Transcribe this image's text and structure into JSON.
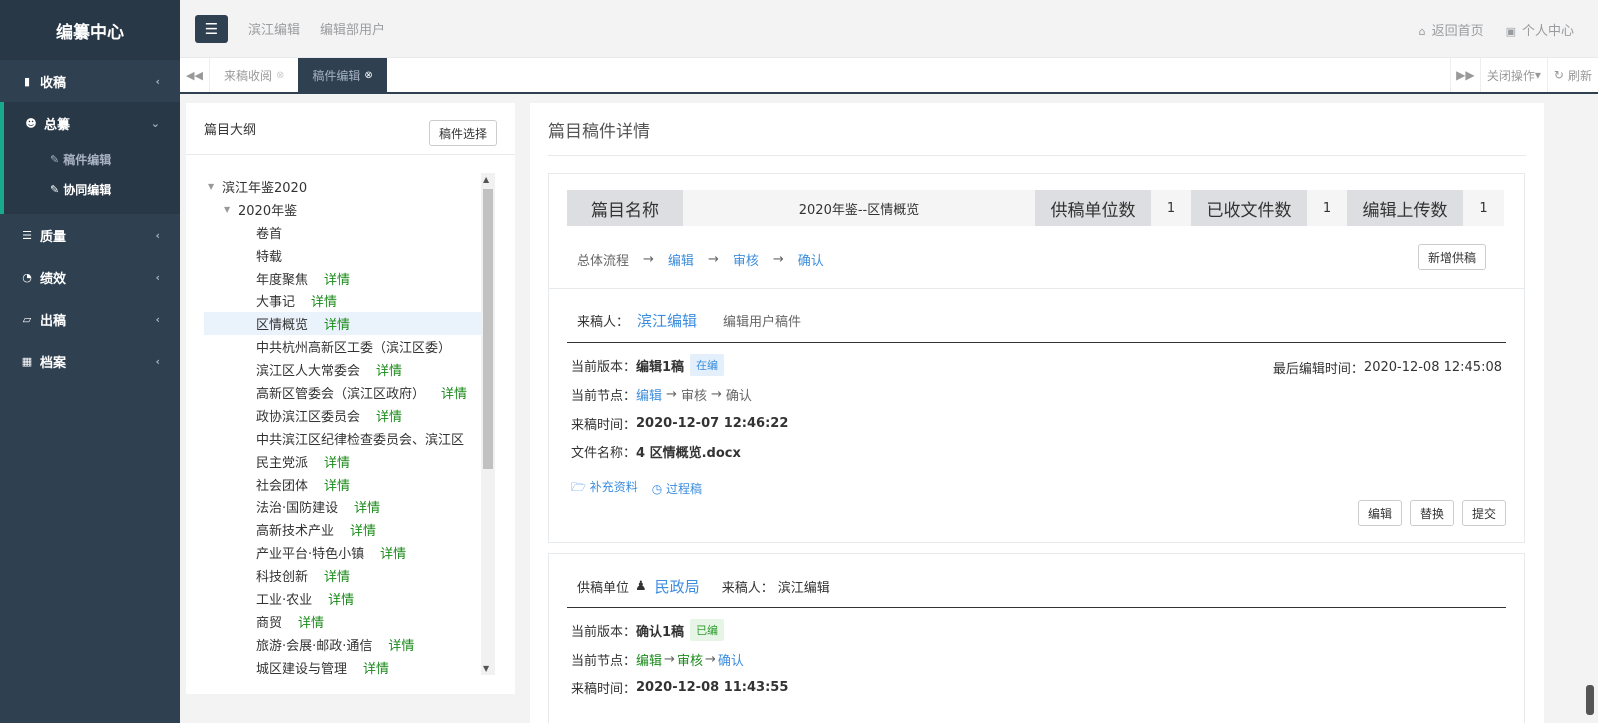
{
  "sidebar": {
    "brand": "编纂中心",
    "items": [
      {
        "label": "收稿",
        "icon": "bookmark-icon"
      },
      {
        "label": "总纂",
        "icon": "users-icon"
      },
      {
        "label": "质量",
        "icon": "list-icon"
      },
      {
        "label": "绩效",
        "icon": "pie-chart-icon"
      },
      {
        "label": "出稿",
        "icon": "book-icon"
      },
      {
        "label": "档案",
        "icon": "grid-icon"
      }
    ],
    "sub_items": [
      {
        "label": "稿件编辑",
        "icon": "edit-icon"
      },
      {
        "label": "协同编辑",
        "icon": "edit-icon"
      }
    ]
  },
  "topbar": {
    "links": [
      "滨江编辑",
      "编辑部用户"
    ],
    "home": "返回首页",
    "profile": "个人中心"
  },
  "tabs": {
    "items": [
      "来稿收阅",
      "稿件编辑"
    ],
    "close_ops": "关闭操作",
    "refresh": "刷新"
  },
  "outline": {
    "title": "篇目大纲",
    "select_button": "稿件选择",
    "detail_label": "详情",
    "nodes": [
      {
        "label": "滨江年鉴2020",
        "level": 0,
        "expanded": true,
        "detail": false
      },
      {
        "label": "2020年鉴",
        "level": 1,
        "expanded": true,
        "detail": false
      },
      {
        "label": "卷首",
        "level": 2,
        "detail": false
      },
      {
        "label": "特载",
        "level": 2,
        "detail": false
      },
      {
        "label": "年度聚焦",
        "level": 2,
        "detail": true
      },
      {
        "label": "大事记",
        "level": 2,
        "detail": true
      },
      {
        "label": "区情概览",
        "level": 2,
        "detail": true,
        "selected": true
      },
      {
        "label": "中共杭州高新区工委（滨江区委）",
        "level": 2,
        "detail": false
      },
      {
        "label": "滨江区人大常委会",
        "level": 2,
        "detail": true
      },
      {
        "label": "高新区管委会（滨江区政府）",
        "level": 2,
        "detail": true
      },
      {
        "label": "政协滨江区委员会",
        "level": 2,
        "detail": true
      },
      {
        "label": "中共滨江区纪律检查委员会、滨江区",
        "level": 2,
        "detail": false
      },
      {
        "label": "民主党派",
        "level": 2,
        "detail": true
      },
      {
        "label": "社会团体",
        "level": 2,
        "detail": true
      },
      {
        "label": "法治·国防建设",
        "level": 2,
        "detail": true
      },
      {
        "label": "高新技术产业",
        "level": 2,
        "detail": true
      },
      {
        "label": "产业平台·特色小镇",
        "level": 2,
        "detail": true
      },
      {
        "label": "科技创新",
        "level": 2,
        "detail": true
      },
      {
        "label": "工业·农业",
        "level": 2,
        "detail": true
      },
      {
        "label": "商贸",
        "level": 2,
        "detail": true
      },
      {
        "label": "旅游·会展·邮政·通信",
        "level": 2,
        "detail": true
      },
      {
        "label": "城区建设与管理",
        "level": 2,
        "detail": true
      }
    ]
  },
  "detail": {
    "title": "篇目稿件详情",
    "info": {
      "name_label": "篇目名称",
      "name_value": "2020年鉴--区情概览",
      "units_label": "供稿单位数",
      "units_value": "1",
      "received_label": "已收文件数",
      "received_value": "1",
      "uploaded_label": "编辑上传数",
      "uploaded_value": "1"
    },
    "flow": {
      "label": "总体流程",
      "steps": [
        "编辑",
        "审核",
        "确认"
      ],
      "add_button": "新增供稿"
    },
    "sub1": {
      "sender_label": "来稿人：",
      "sender": "滨江编辑",
      "note": "编辑用户稿件",
      "version_label": "当前版本：",
      "version": "编辑1稿",
      "version_badge": "在编",
      "last_edit_label": "最后编辑时间：",
      "last_edit": "2020-12-08 12:45:08",
      "node_label": "当前节点：",
      "nodes": [
        "编辑",
        "审核",
        "确认"
      ],
      "time_label": "来稿时间：",
      "time": "2020-12-07 12:46:22",
      "file_label": "文件名称：",
      "file": "4 区情概览.docx",
      "supplement": "补充资料",
      "process": "过程稿",
      "actions": [
        "编辑",
        "替换",
        "提交"
      ]
    },
    "sub2": {
      "unit_label": "供稿单位",
      "unit": "民政局",
      "sender_label": "来稿人：",
      "sender": "滨江编辑",
      "version_label": "当前版本：",
      "version": "确认1稿",
      "version_badge": "已编",
      "node_label": "当前节点：",
      "nodes": [
        "编辑",
        "审核",
        "确认"
      ],
      "time_label": "来稿时间：",
      "time": "2020-12-08 11:43:55"
    }
  }
}
